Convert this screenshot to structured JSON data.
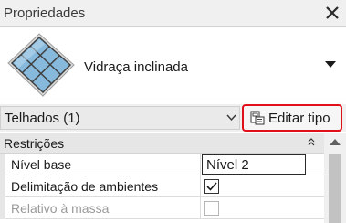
{
  "panel": {
    "title": "Propriedades",
    "close_icon": "close-x-icon"
  },
  "type_selector": {
    "type_name": "Vidraça inclinada",
    "thumbnail_icon": "sloped-glazing-icon",
    "dropdown_icon": "triangle-down-icon",
    "thumb_color": "#7fb2d6"
  },
  "filter": {
    "label": "Telhados (1)",
    "chevron_icon": "chevron-down-icon",
    "edit_type_label": "Editar tipo",
    "edit_type_icon": "edit-type-icon",
    "highlight_color": "#e0101a"
  },
  "properties": {
    "group_label": "Restrições",
    "collapse_icon": "collapse-up-icon",
    "rows": [
      {
        "name": "Nível base",
        "value": "Nível 2",
        "kind": "text",
        "enabled": true
      },
      {
        "name": "Delimitação de ambientes",
        "value": "checked",
        "kind": "checkbox",
        "enabled": true
      },
      {
        "name": "Relativo à massa",
        "value": "unchecked",
        "kind": "checkbox",
        "enabled": false
      }
    ]
  }
}
